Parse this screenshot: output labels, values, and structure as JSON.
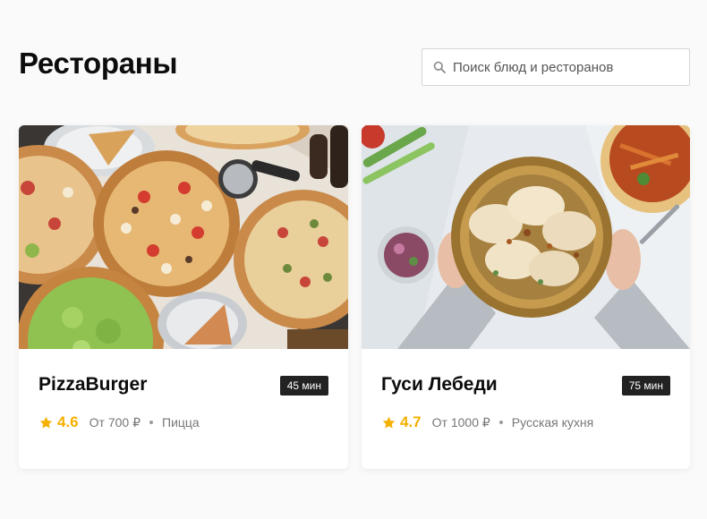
{
  "header": {
    "title": "Рестораны",
    "search_placeholder": "Поиск блюд и ресторанов"
  },
  "colors": {
    "rating": "#f5b000",
    "badge_bg": "#222222",
    "page_bg": "#fafafa"
  },
  "restaurants": [
    {
      "name": "PizzaBurger",
      "delivery_time": "45 мин",
      "rating": "4.6",
      "price": "От 700 ₽",
      "cuisine": "Пицца",
      "image": "pizza-photo"
    },
    {
      "name": "Гуси Лебеди",
      "delivery_time": "75 мин",
      "rating": "4.7",
      "price": "От 1000 ₽",
      "cuisine": "Русская кухня",
      "image": "dumplings-photo"
    }
  ]
}
